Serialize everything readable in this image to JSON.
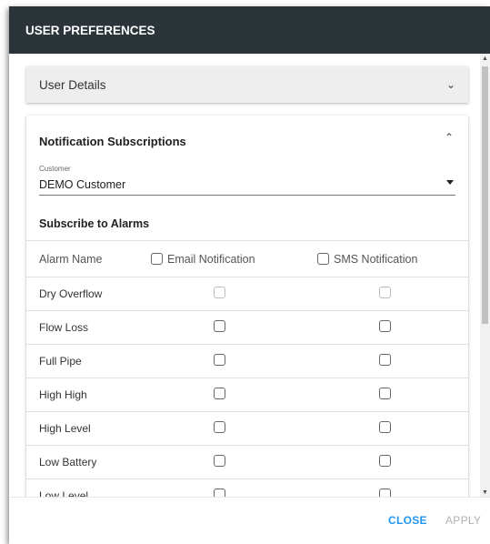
{
  "dialog": {
    "title": "USER PREFERENCES",
    "panels": {
      "user_details": {
        "label": "User Details"
      },
      "notifications": {
        "label": "Notification Subscriptions",
        "customer_label": "Customer",
        "customer_value": "DEMO Customer",
        "subscribe_label": "Subscribe to Alarms",
        "columns": {
          "name": "Alarm Name",
          "email": "Email Notification",
          "sms": "SMS Notification"
        },
        "rows": [
          {
            "name": "Dry Overflow"
          },
          {
            "name": "Flow Loss"
          },
          {
            "name": "Full Pipe"
          },
          {
            "name": "High High"
          },
          {
            "name": "High Level"
          },
          {
            "name": "Low Battery"
          },
          {
            "name": "Low Level"
          }
        ]
      }
    },
    "footer": {
      "close_label": "CLOSE",
      "apply_label": "APPLY"
    }
  },
  "colors": {
    "header_bg": "#2b3539",
    "accent": "#2196f3",
    "disabled": "#b0b0b0"
  },
  "icons": {
    "expand": "chevron-down-icon",
    "collapse": "chevron-up-icon",
    "dropdown": "caret-down-icon"
  }
}
